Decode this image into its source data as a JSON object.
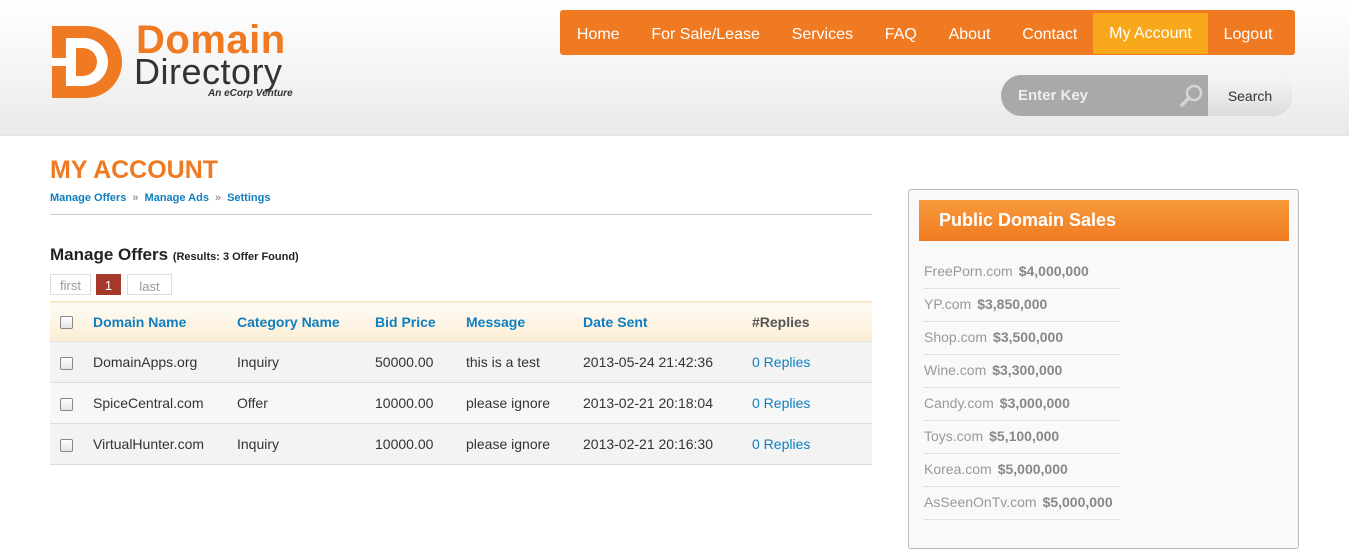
{
  "logo": {
    "word1": "Domain",
    "word2": "Directory",
    "tagline": "An eCorp Venture"
  },
  "nav": [
    {
      "label": "Home",
      "active": false
    },
    {
      "label": "For Sale/Lease",
      "active": false
    },
    {
      "label": "Services",
      "active": false
    },
    {
      "label": "FAQ",
      "active": false
    },
    {
      "label": "About",
      "active": false
    },
    {
      "label": "Contact",
      "active": false
    },
    {
      "label": "My Account",
      "active": true
    },
    {
      "label": "Logout",
      "active": false
    }
  ],
  "search": {
    "placeholder": "Enter Key",
    "button": "Search"
  },
  "page": {
    "title": "MY ACCOUNT",
    "breadcrumb": [
      "Manage Offers",
      "Manage Ads",
      "Settings"
    ],
    "breadcrumb_sep": "»"
  },
  "offers": {
    "title": "Manage Offers",
    "results": "(Results: 3 Offer Found)",
    "pager": {
      "first": "first",
      "current": "1",
      "last": "last"
    },
    "columns": [
      "Domain Name",
      "Category Name",
      "Bid Price",
      "Message",
      "Date Sent",
      "#Replies"
    ],
    "rows": [
      {
        "domain": "DomainApps.org",
        "category": "Inquiry",
        "bid": "50000.00",
        "message": "this is a test",
        "date": "2013-05-24 21:42:36",
        "replies": "0 Replies"
      },
      {
        "domain": "SpiceCentral.com",
        "category": "Offer",
        "bid": "10000.00",
        "message": "please ignore",
        "date": "2013-02-21 20:18:04",
        "replies": "0 Replies"
      },
      {
        "domain": "VirtualHunter.com",
        "category": "Inquiry",
        "bid": "10000.00",
        "message": "please ignore",
        "date": "2013-02-21 20:16:30",
        "replies": "0 Replies"
      }
    ]
  },
  "sidebar": {
    "title": "Public Domain Sales",
    "sales": [
      {
        "domain": "FreePorn.com",
        "price": "$4,000,000"
      },
      {
        "domain": "YP.com",
        "price": "$3,850,000"
      },
      {
        "domain": "Shop.com",
        "price": "$3,500,000"
      },
      {
        "domain": "Wine.com",
        "price": "$3,300,000"
      },
      {
        "domain": "Candy.com",
        "price": "$3,000,000"
      },
      {
        "domain": "Toys.com",
        "price": "$5,100,000"
      },
      {
        "domain": "Korea.com",
        "price": "$5,000,000"
      },
      {
        "domain": "AsSeenOnTv.com",
        "price": "$5,000,000"
      }
    ]
  },
  "colors": {
    "brand_orange": "#f07a22",
    "nav_active": "#f9a81b",
    "link_blue": "#0e7fc1",
    "pager_current": "#a53a2c"
  }
}
